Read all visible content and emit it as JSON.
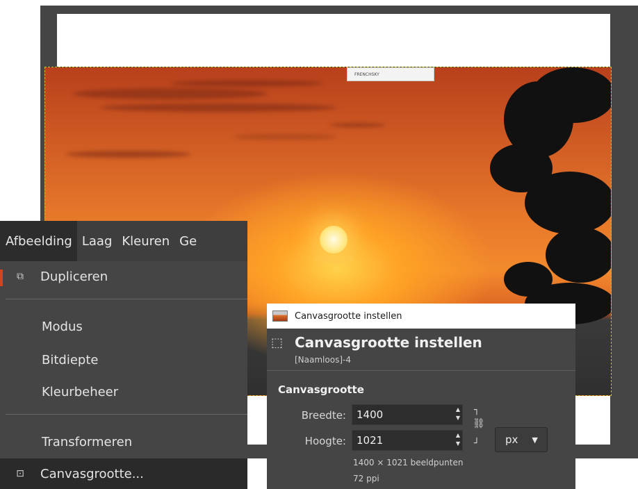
{
  "image_canvas": {
    "watermark_text": "FRENCHSKY"
  },
  "menu": {
    "menubar": [
      {
        "label": "Afbeelding",
        "active": true
      },
      {
        "label": "Laag"
      },
      {
        "label": "Kleuren"
      },
      {
        "label": "Ge"
      }
    ],
    "items": [
      {
        "label": "Dupliceren",
        "icon": "duplicate-icon"
      },
      {
        "label": "Modus"
      },
      {
        "label": "Bitdiepte"
      },
      {
        "label": "Kleurbeheer"
      },
      {
        "label": "Transformeren"
      },
      {
        "label": "Canvasgrootte...",
        "icon": "canvas-size-icon",
        "highlighted": true
      }
    ]
  },
  "dialog": {
    "window_title": "Canvasgrootte instellen",
    "heading": "Canvasgrootte instellen",
    "subtitle": "[Naamloos]-4",
    "section_title": "Canvasgrootte",
    "width_label": "Breedte:",
    "width_value": "1400",
    "height_label": "Hoogte:",
    "height_value": "1021",
    "unit": "px",
    "size_info": "1400 × 1021 beeldpunten",
    "resolution_info": "72 ppi",
    "chain_linked": true
  },
  "colors": {
    "workspace_bg": "#454545",
    "menu_bg": "#454545",
    "highlight_bg": "#2a2a2a",
    "accent_marker": "#d0451b"
  }
}
